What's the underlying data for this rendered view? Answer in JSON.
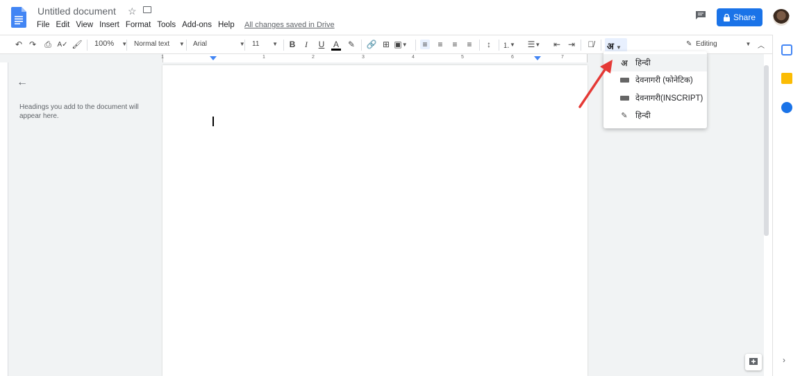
{
  "header": {
    "title": "Untitled document",
    "menu": [
      "File",
      "Edit",
      "View",
      "Insert",
      "Format",
      "Tools",
      "Add-ons",
      "Help"
    ],
    "saved_status": "All changes saved in Drive",
    "share_label": "Share"
  },
  "toolbar": {
    "zoom": "100%",
    "style": "Normal text",
    "font": "Arial",
    "font_size": "11",
    "input_tool_glyph": "अ",
    "mode_label": "Editing"
  },
  "ruler": {
    "numbers": [
      "1",
      "1",
      "2",
      "3",
      "4",
      "5",
      "6",
      "7"
    ]
  },
  "outline": {
    "hint": "Headings you add to the document will appear here."
  },
  "input_tools_menu": {
    "items": [
      {
        "icon": "devanagari-a-icon",
        "glyph": "अ",
        "label": "हिन्दी"
      },
      {
        "icon": "keyboard-icon",
        "label": "देवनागरी (फोनेटिक)"
      },
      {
        "icon": "keyboard-icon",
        "label": "देवनागरी(INSCRIPT)"
      },
      {
        "icon": "pencil-icon",
        "label": "हिन्दी"
      }
    ]
  },
  "colors": {
    "accent": "#1a73e8",
    "arrow": "#e53935",
    "canvas": "#f1f3f4"
  }
}
